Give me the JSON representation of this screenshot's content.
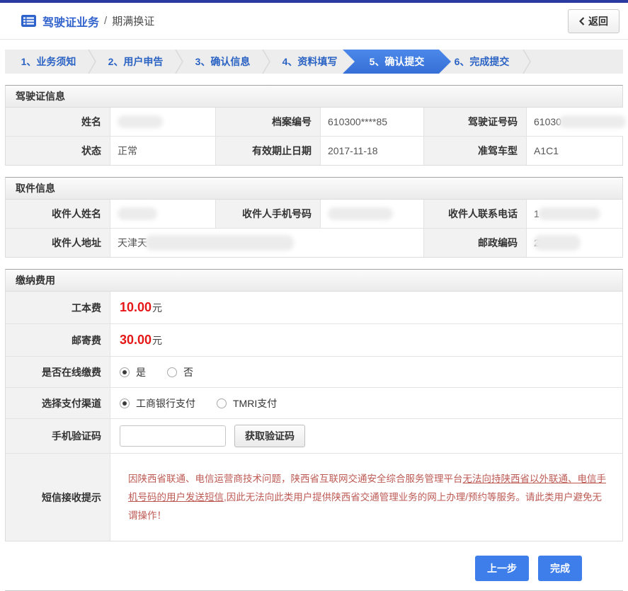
{
  "header": {
    "title": "驾驶证业务",
    "separator": "/",
    "subtitle": "期满换证",
    "back_label": "返回"
  },
  "steps": [
    {
      "label": "1、业务须知",
      "active": false
    },
    {
      "label": "2、用户申告",
      "active": false
    },
    {
      "label": "3、确认信息",
      "active": false
    },
    {
      "label": "4、资料填写",
      "active": false
    },
    {
      "label": "5、确认提交",
      "active": true
    },
    {
      "label": "6、完成提交",
      "active": false
    }
  ],
  "license": {
    "title": "驾驶证信息",
    "name_label": "姓名",
    "name_value": "",
    "file_no_label": "档案编号",
    "file_no_value": "610300****85",
    "license_no_label": "驾驶证号码",
    "license_no_value": "61030",
    "status_label": "状态",
    "status_value": "正常",
    "expiry_label": "有效期止日期",
    "expiry_value": "2017-11-18",
    "vehicle_label": "准驾车型",
    "vehicle_value": "A1C1"
  },
  "pickup": {
    "title": "取件信息",
    "name_label": "收件人姓名",
    "name_value": "",
    "mobile_label": "收件人手机号码",
    "mobile_value": "",
    "phone_label": "收件人联系电话",
    "phone_value": "1",
    "address_label": "收件人地址",
    "address_value": "天津天",
    "postcode_label": "邮政编码",
    "postcode_value": "2"
  },
  "payment": {
    "title": "缴纳费用",
    "card_fee_label": "工本费",
    "card_fee_value": "10.00",
    "card_fee_unit": "元",
    "postage_label": "邮寄费",
    "postage_value": "30.00",
    "postage_unit": "元",
    "online_label": "是否在线缴费",
    "yes_label": "是",
    "no_label": "否",
    "online_selected": "是",
    "channel_label": "选择支付渠道",
    "channel_icbc": "工商银行支付",
    "channel_tmri": "TMRI支付",
    "channel_selected": "工商银行支付",
    "code_label": "手机验证码",
    "code_value": "",
    "get_code_label": "获取验证码",
    "notice_label": "短信接收提示",
    "notice_part1": "因陕西省联通、电信运营商技术问题，陕西省互联网交通安全综合服务管理平台",
    "notice_underline": "无法向持陕西省以外联通、电信手机号码的用户发送短信",
    "notice_part2": ",因此无法向此类用户提供陕西省交通管理业务的网上办理/预约等服务。请此类用户避免无谓操作！"
  },
  "footer": {
    "prev_label": "上一步",
    "finish_label": "完成"
  },
  "colors": {
    "top_border": "#2a3aa0",
    "accent_blue": "#3d7eea",
    "active_step_blue": "#3b7de2",
    "step_text_blue": "#2b63c4",
    "fee_red": "#e61717",
    "notice_red": "#bd5a54"
  }
}
